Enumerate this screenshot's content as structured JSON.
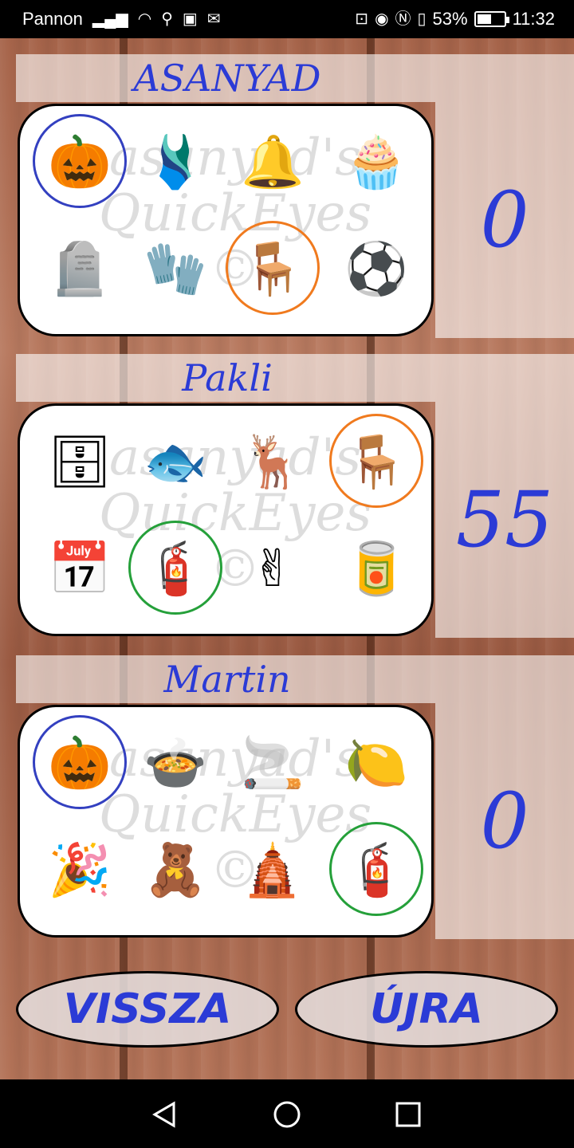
{
  "status_bar": {
    "carrier": "Pannon",
    "battery": "53%",
    "time": "11:32",
    "battery_level": 0.53
  },
  "players": [
    {
      "name": "ASANYAD",
      "score": "0",
      "items": [
        {
          "icon": "pumpkin-scarecrow-icon",
          "glyph": "🎃",
          "ring": "#3340c0"
        },
        {
          "icon": "wetsuit-icon",
          "glyph": "🩱",
          "ring": ""
        },
        {
          "icon": "bell-icon",
          "glyph": "🔔",
          "ring": ""
        },
        {
          "icon": "muffin-icon",
          "glyph": "🧁",
          "ring": ""
        },
        {
          "icon": "gravestone-icon",
          "glyph": "🪦",
          "ring": ""
        },
        {
          "icon": "glove-icon",
          "glyph": "🧤",
          "ring": ""
        },
        {
          "icon": "chair-icon",
          "glyph": "🪑",
          "ring": "#f07a1e"
        },
        {
          "icon": "beach-ball-icon",
          "glyph": "⚽",
          "ring": ""
        }
      ]
    },
    {
      "name": "Pakli",
      "score": "55",
      "items": [
        {
          "icon": "grill-icon",
          "glyph": "🗄",
          "ring": ""
        },
        {
          "icon": "fish-icon",
          "glyph": "🐟",
          "ring": ""
        },
        {
          "icon": "antler-icon",
          "glyph": "🦌",
          "ring": ""
        },
        {
          "icon": "chair-icon",
          "glyph": "🪑",
          "ring": "#f07a1e"
        },
        {
          "icon": "calendar-icon",
          "glyph": "📅",
          "ring": ""
        },
        {
          "icon": "fire-hydrant-icon",
          "glyph": "🧯",
          "ring": "#25a03a"
        },
        {
          "icon": "victory-hand-icon",
          "glyph": "✌",
          "ring": ""
        },
        {
          "icon": "cola-can-icon",
          "glyph": "🥫",
          "ring": ""
        }
      ]
    },
    {
      "name": "Martin",
      "score": "0",
      "items": [
        {
          "icon": "pumpkin-scarecrow-icon",
          "glyph": "🎃",
          "ring": "#3340c0"
        },
        {
          "icon": "cauldron-icon",
          "glyph": "🍲",
          "ring": ""
        },
        {
          "icon": "pipe-icon",
          "glyph": "🚬",
          "ring": ""
        },
        {
          "icon": "juicer-icon",
          "glyph": "🍋",
          "ring": ""
        },
        {
          "icon": "party-hat-icon",
          "glyph": "🎉",
          "ring": ""
        },
        {
          "icon": "teddy-bear-icon",
          "glyph": "🧸",
          "ring": ""
        },
        {
          "icon": "pyramid-icon",
          "glyph": "🛕",
          "ring": ""
        },
        {
          "icon": "fire-hydrant-icon",
          "glyph": "🧯",
          "ring": "#25a03a"
        }
      ]
    }
  ],
  "watermark": "asanyad's QuickEyes ©",
  "buttons": {
    "back": "VISSZA",
    "restart": "ÚJRA"
  },
  "colors": {
    "accent": "#2b3bd6",
    "ring_blue": "#3340c0",
    "ring_orange": "#f07a1e",
    "ring_green": "#25a03a"
  }
}
